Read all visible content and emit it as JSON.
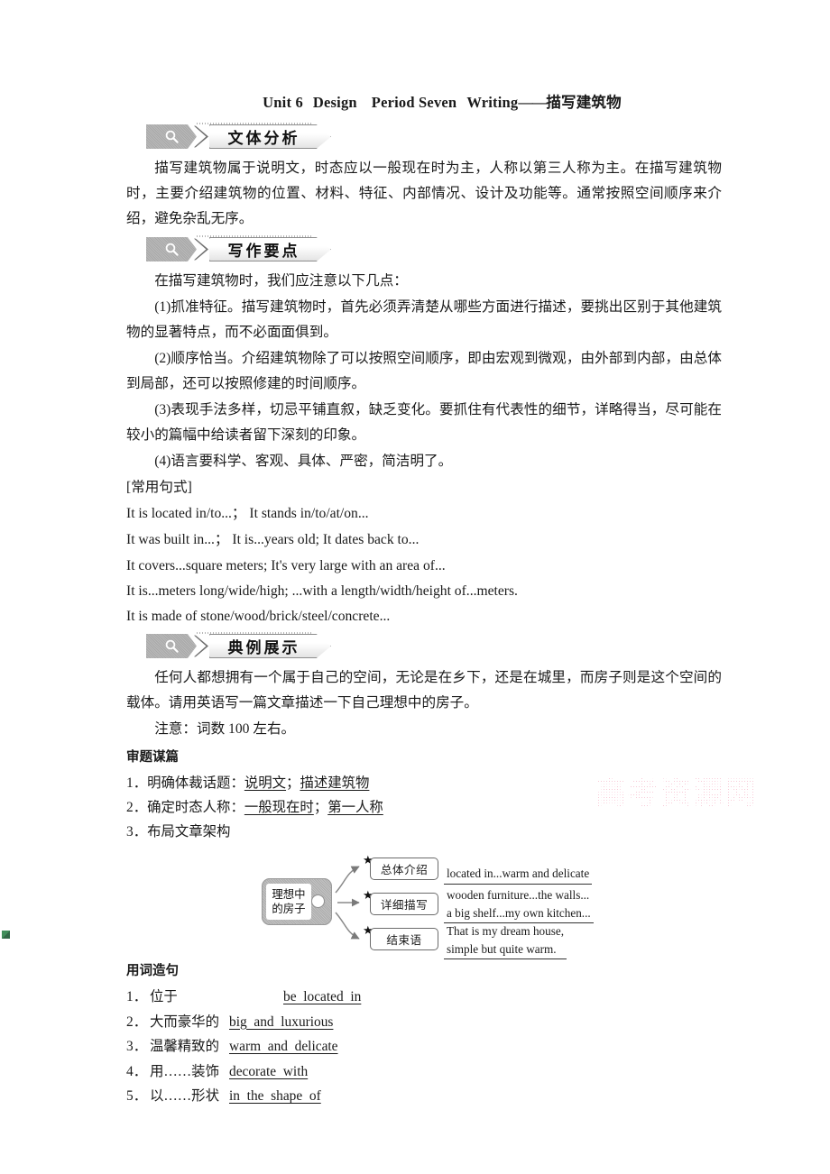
{
  "document": {
    "title_parts": {
      "unit": "Unit 6",
      "unit_name": "Design",
      "period": "Period Seven",
      "skill": "Writing",
      "dash": "——",
      "topic": "描写建筑物"
    }
  },
  "sections": [
    {
      "badge": "文体分析",
      "icon": "magnifier-icon",
      "paragraphs": [
        "描写建筑物属于说明文，时态应以一般现在时为主，人称以第三人称为主。在描写建筑物时，主要介绍建筑物的位置、材料、特征、内部情况、设计及功能等。通常按照空间顺序来介绍，避免杂乱无序。"
      ]
    },
    {
      "badge": "写作要点",
      "icon": "magnifier-icon",
      "lead": "在描写建筑物时，我们应注意以下几点：",
      "points": [
        "(1)抓准特征。描写建筑物时，首先必须弄清楚从哪些方面进行描述，要挑出区别于其他建筑物的显著特点，而不必面面俱到。",
        "(2)顺序恰当。介绍建筑物除了可以按照空间顺序，即由宏观到微观，由外部到内部，由总体到局部，还可以按照修建的时间顺序。",
        "(3)表现手法多样，切忌平铺直叙，缺乏变化。要抓住有代表性的细节，详略得当，尽可能在较小的篇幅中给读者留下深刻的印象。",
        "(4)语言要科学、客观、具体、严密，简洁明了。"
      ],
      "patterns_heading": "[常用句式]",
      "patterns": [
        "It is located in/to...；  It stands in/to/at/on...",
        "It was built in...；  It is...years old; It dates back to...",
        "It covers...square meters; It's very large with an area of...",
        "It is...meters long/wide/high; ...with a length/width/height of...meters.",
        "It is made of stone/wood/brick/steel/concrete..."
      ]
    },
    {
      "badge": "典例展示",
      "icon": "magnifier-icon",
      "prompt": "任何人都想拥有一个属于自己的空间，无论是在乡下，还是在城里，而房子则是这个空间的载体。请用英语写一篇文章描述一下自己理想中的房子。",
      "note": "注意：词数 100 左右。",
      "analysis_heading": "审题谋篇",
      "analysis_items": [
        {
          "index": "1．",
          "label": "明确体裁话题：",
          "answer_a": "说明文",
          "sep": "；",
          "answer_b": "描述建筑物"
        },
        {
          "index": "2．",
          "label": "确定时态人称：",
          "answer_a": "一般现在时",
          "sep": "；",
          "answer_b": "第一人称"
        },
        {
          "index": "3．",
          "label": "布局文章架构",
          "answer_a": "",
          "sep": "",
          "answer_b": ""
        }
      ]
    }
  ],
  "diagram": {
    "center_node": {
      "line1": "理想中",
      "line2": "的房子"
    },
    "star_glyph": "★",
    "branches": [
      {
        "box": "总体介绍",
        "lines": [
          "located in...warm and delicate"
        ],
        "underlined": [
          true
        ]
      },
      {
        "box": "详细描写",
        "lines": [
          "wooden furniture...the walls...",
          "a big shelf...my own kitchen..."
        ],
        "underlined": [
          false,
          true
        ]
      },
      {
        "box": "结束语",
        "lines": [
          "That is my dream house,",
          "simple but quite warm."
        ],
        "underlined": [
          false,
          true
        ]
      }
    ]
  },
  "word_section": {
    "heading": "用词造句",
    "rows": [
      {
        "index": "1．",
        "cn": "位于",
        "cn_width": 148,
        "en": "be located in"
      },
      {
        "index": "2．",
        "cn": "大而豪华的",
        "cn_width": 88,
        "en": "big and luxurious"
      },
      {
        "index": "3．",
        "cn": "温馨精致的",
        "cn_width": 88,
        "en": "warm and delicate"
      },
      {
        "index": "4．",
        "cn": "用……装饰",
        "cn_width": 88,
        "en": "decorate with"
      },
      {
        "index": "5．",
        "cn": "以……形状",
        "cn_width": 88,
        "en": "in the shape of"
      }
    ]
  },
  "watermark": {
    "text": "高考资源网",
    "color": "#f6b7c8"
  }
}
